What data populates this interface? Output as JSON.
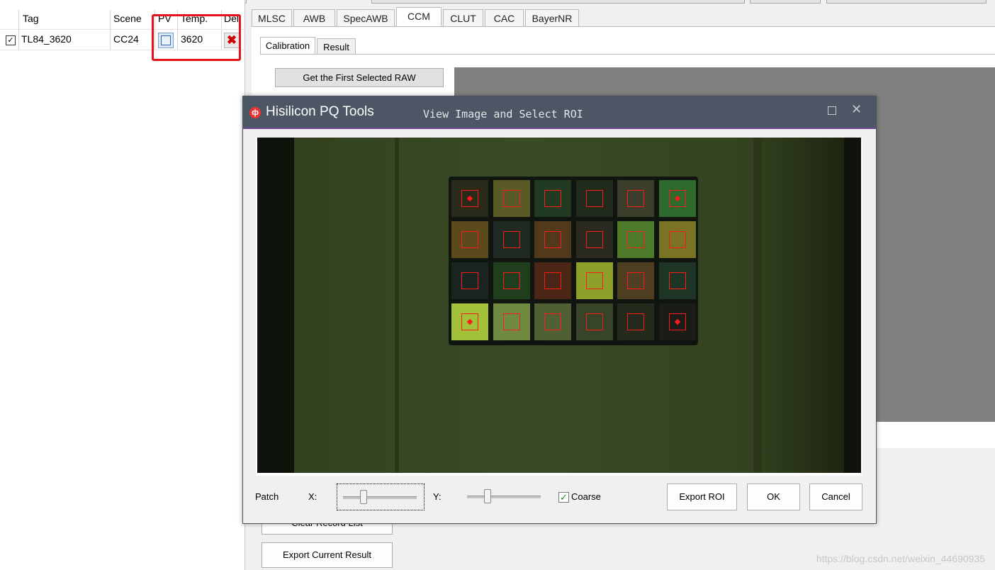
{
  "record_table": {
    "columns": [
      "Tag",
      "Scene",
      "PV",
      "Temp.",
      "Del"
    ],
    "rows": [
      {
        "checked": true,
        "tag": "TL84_3620",
        "scene": "CC24",
        "temp": "3620"
      }
    ]
  },
  "module_tabs": [
    "MLSC",
    "AWB",
    "SpecAWB",
    "CCM",
    "CLUT",
    "CAC",
    "BayerNR"
  ],
  "active_module_tab": "CCM",
  "sub_tabs": [
    "Calibration",
    "Result"
  ],
  "active_sub_tab": "Calibration",
  "buttons": {
    "get_first_raw": "Get the First Selected RAW",
    "clear_record_list": "Clear Record List",
    "export_current_result": "Export Current Result"
  },
  "dialog": {
    "app_name": "Hisilicon PQ Tools",
    "title": "View Image and Select ROI",
    "patch_label": "Patch",
    "x_label": "X:",
    "y_label": "Y:",
    "coarse_label": "Coarse",
    "coarse_checked": true,
    "export_roi": "Export ROI",
    "ok": "OK",
    "cancel": "Cancel",
    "x_slider_value": 0.25,
    "y_slider_value": 0.25,
    "colorchecker_patches": [
      [
        "#2a2a1a",
        "#5a5a28",
        "#233a22",
        "#1f2a1a",
        "#3a3e2a",
        "#2e6a2c"
      ],
      [
        "#5d4a1c",
        "#1e2a22",
        "#53391c",
        "#2a2a20",
        "#4d7a28",
        "#7a7324"
      ],
      [
        "#1a2420",
        "#1f3e1e",
        "#4a2616",
        "#8ea02a",
        "#4e3e22",
        "#1e3424"
      ],
      [
        "#a3c23a",
        "#6f8a40",
        "#4f6034",
        "#384428",
        "#242a1c",
        "#1a1c18"
      ]
    ],
    "roi_markers_with_dot": [
      [
        0,
        0
      ],
      [
        0,
        5
      ],
      [
        3,
        0
      ],
      [
        3,
        5
      ]
    ]
  },
  "watermark": "https://blog.csdn.net/weixin_44690935"
}
